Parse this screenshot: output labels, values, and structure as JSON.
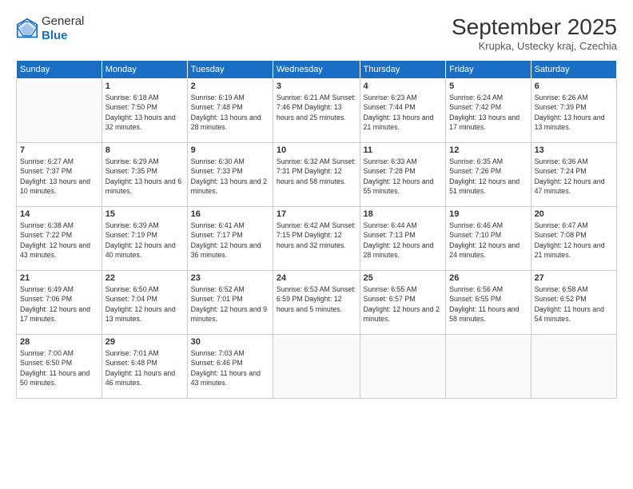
{
  "logo": {
    "general": "General",
    "blue": "Blue"
  },
  "title": "September 2025",
  "location": "Krupka, Ustecky kraj, Czechia",
  "days_of_week": [
    "Sunday",
    "Monday",
    "Tuesday",
    "Wednesday",
    "Thursday",
    "Friday",
    "Saturday"
  ],
  "weeks": [
    [
      {
        "day": "",
        "info": ""
      },
      {
        "day": "1",
        "info": "Sunrise: 6:18 AM\nSunset: 7:50 PM\nDaylight: 13 hours\nand 32 minutes."
      },
      {
        "day": "2",
        "info": "Sunrise: 6:19 AM\nSunset: 7:48 PM\nDaylight: 13 hours\nand 28 minutes."
      },
      {
        "day": "3",
        "info": "Sunrise: 6:21 AM\nSunset: 7:46 PM\nDaylight: 13 hours\nand 25 minutes."
      },
      {
        "day": "4",
        "info": "Sunrise: 6:23 AM\nSunset: 7:44 PM\nDaylight: 13 hours\nand 21 minutes."
      },
      {
        "day": "5",
        "info": "Sunrise: 6:24 AM\nSunset: 7:42 PM\nDaylight: 13 hours\nand 17 minutes."
      },
      {
        "day": "6",
        "info": "Sunrise: 6:26 AM\nSunset: 7:39 PM\nDaylight: 13 hours\nand 13 minutes."
      }
    ],
    [
      {
        "day": "7",
        "info": "Sunrise: 6:27 AM\nSunset: 7:37 PM\nDaylight: 13 hours\nand 10 minutes."
      },
      {
        "day": "8",
        "info": "Sunrise: 6:29 AM\nSunset: 7:35 PM\nDaylight: 13 hours\nand 6 minutes."
      },
      {
        "day": "9",
        "info": "Sunrise: 6:30 AM\nSunset: 7:33 PM\nDaylight: 13 hours\nand 2 minutes."
      },
      {
        "day": "10",
        "info": "Sunrise: 6:32 AM\nSunset: 7:31 PM\nDaylight: 12 hours\nand 58 minutes."
      },
      {
        "day": "11",
        "info": "Sunrise: 6:33 AM\nSunset: 7:28 PM\nDaylight: 12 hours\nand 55 minutes."
      },
      {
        "day": "12",
        "info": "Sunrise: 6:35 AM\nSunset: 7:26 PM\nDaylight: 12 hours\nand 51 minutes."
      },
      {
        "day": "13",
        "info": "Sunrise: 6:36 AM\nSunset: 7:24 PM\nDaylight: 12 hours\nand 47 minutes."
      }
    ],
    [
      {
        "day": "14",
        "info": "Sunrise: 6:38 AM\nSunset: 7:22 PM\nDaylight: 12 hours\nand 43 minutes."
      },
      {
        "day": "15",
        "info": "Sunrise: 6:39 AM\nSunset: 7:19 PM\nDaylight: 12 hours\nand 40 minutes."
      },
      {
        "day": "16",
        "info": "Sunrise: 6:41 AM\nSunset: 7:17 PM\nDaylight: 12 hours\nand 36 minutes."
      },
      {
        "day": "17",
        "info": "Sunrise: 6:42 AM\nSunset: 7:15 PM\nDaylight: 12 hours\nand 32 minutes."
      },
      {
        "day": "18",
        "info": "Sunrise: 6:44 AM\nSunset: 7:13 PM\nDaylight: 12 hours\nand 28 minutes."
      },
      {
        "day": "19",
        "info": "Sunrise: 6:46 AM\nSunset: 7:10 PM\nDaylight: 12 hours\nand 24 minutes."
      },
      {
        "day": "20",
        "info": "Sunrise: 6:47 AM\nSunset: 7:08 PM\nDaylight: 12 hours\nand 21 minutes."
      }
    ],
    [
      {
        "day": "21",
        "info": "Sunrise: 6:49 AM\nSunset: 7:06 PM\nDaylight: 12 hours\nand 17 minutes."
      },
      {
        "day": "22",
        "info": "Sunrise: 6:50 AM\nSunset: 7:04 PM\nDaylight: 12 hours\nand 13 minutes."
      },
      {
        "day": "23",
        "info": "Sunrise: 6:52 AM\nSunset: 7:01 PM\nDaylight: 12 hours\nand 9 minutes."
      },
      {
        "day": "24",
        "info": "Sunrise: 6:53 AM\nSunset: 6:59 PM\nDaylight: 12 hours\nand 5 minutes."
      },
      {
        "day": "25",
        "info": "Sunrise: 6:55 AM\nSunset: 6:57 PM\nDaylight: 12 hours\nand 2 minutes."
      },
      {
        "day": "26",
        "info": "Sunrise: 6:56 AM\nSunset: 6:55 PM\nDaylight: 11 hours\nand 58 minutes."
      },
      {
        "day": "27",
        "info": "Sunrise: 6:58 AM\nSunset: 6:52 PM\nDaylight: 11 hours\nand 54 minutes."
      }
    ],
    [
      {
        "day": "28",
        "info": "Sunrise: 7:00 AM\nSunset: 6:50 PM\nDaylight: 11 hours\nand 50 minutes."
      },
      {
        "day": "29",
        "info": "Sunrise: 7:01 AM\nSunset: 6:48 PM\nDaylight: 11 hours\nand 46 minutes."
      },
      {
        "day": "30",
        "info": "Sunrise: 7:03 AM\nSunset: 6:46 PM\nDaylight: 11 hours\nand 43 minutes."
      },
      {
        "day": "",
        "info": ""
      },
      {
        "day": "",
        "info": ""
      },
      {
        "day": "",
        "info": ""
      },
      {
        "day": "",
        "info": ""
      }
    ]
  ]
}
